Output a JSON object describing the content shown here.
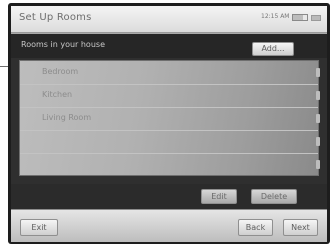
{
  "window": {
    "title": "Set Up Rooms",
    "clock": "12:15 AM"
  },
  "rooms_panel": {
    "heading": "Rooms in your house",
    "add_label": "Add..."
  },
  "rooms": [
    {
      "label": "Bedroom"
    },
    {
      "label": "Kitchen"
    },
    {
      "label": "Living Room"
    }
  ],
  "actions": {
    "edit_label": "Edit",
    "delete_label": "Delete"
  },
  "navigation": {
    "exit_label": "Exit",
    "back_label": "Back",
    "next_label": "Next"
  },
  "colors": {
    "panel_background": "#2f2f2f",
    "list_background": "#b1b1b1",
    "title_bar": "#e8e8e8"
  }
}
